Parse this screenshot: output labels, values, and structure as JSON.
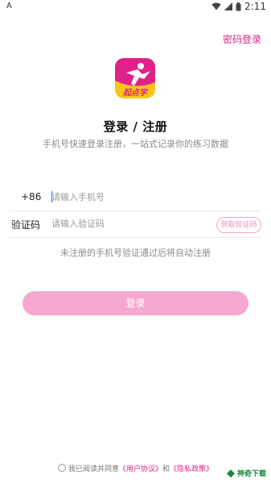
{
  "status_bar": {
    "carrier_icon": "A",
    "time": "2:11"
  },
  "header": {
    "password_login": "密码登录"
  },
  "logo": {
    "text": "起点学",
    "bg": "#f7c61a",
    "accent": "#e0218a"
  },
  "title": "登录 / 注册",
  "subtitle": "手机号快速登录注册，一站式记录你的练习数据",
  "phone": {
    "country_code": "+86",
    "placeholder": "请输入手机号"
  },
  "code": {
    "label": "验证码",
    "placeholder": "请输入验证码",
    "get_code": "获取验证码"
  },
  "hint": "未注册的手机号验证通过后将自动注册",
  "login_button": "登录",
  "agreement": {
    "prefix": "我已阅读并同意",
    "user_agreement": "《用户协议》",
    "and": "和",
    "privacy_policy": "《隐私政策》"
  },
  "watermark": {
    "text": "神奇下载"
  },
  "colors": {
    "accent": "#e0218a",
    "button": "#f5a8d0"
  }
}
